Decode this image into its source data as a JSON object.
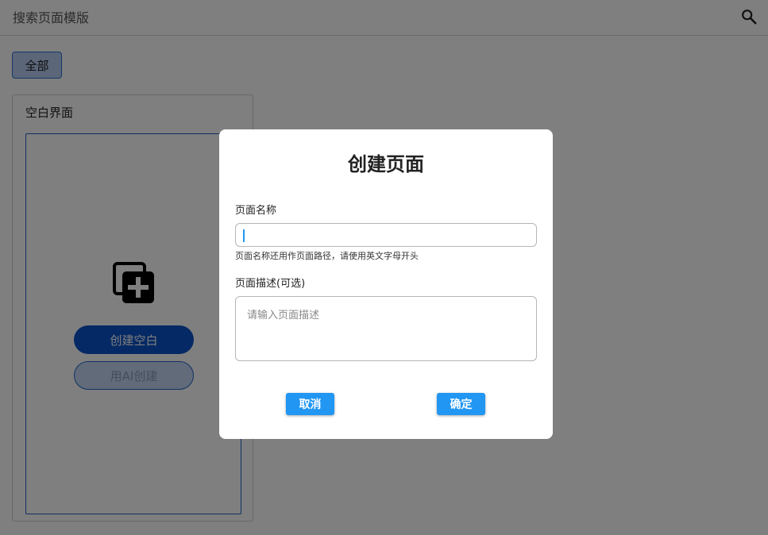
{
  "search": {
    "placeholder": "搜索页面模版",
    "icon": "search-icon"
  },
  "filters": {
    "active_label": "全部"
  },
  "template_card": {
    "title": "空白界面",
    "icon": "add-copy-icon",
    "create_blank_label": "创建空白",
    "create_ai_label": "用AI创建"
  },
  "dialog": {
    "title": "创建页面",
    "name_label": "页面名称",
    "name_value": "",
    "name_hint": "页面名称还用作页面路径，请使用英文字母开头",
    "desc_label": "页面描述(可选)",
    "desc_placeholder": "请输入页面描述",
    "cancel_label": "取消",
    "confirm_label": "确定"
  },
  "colors": {
    "primary": "#0a52c9",
    "dialog_button": "#2196f3",
    "overlay": "rgba(0,0,0,0.5)"
  }
}
